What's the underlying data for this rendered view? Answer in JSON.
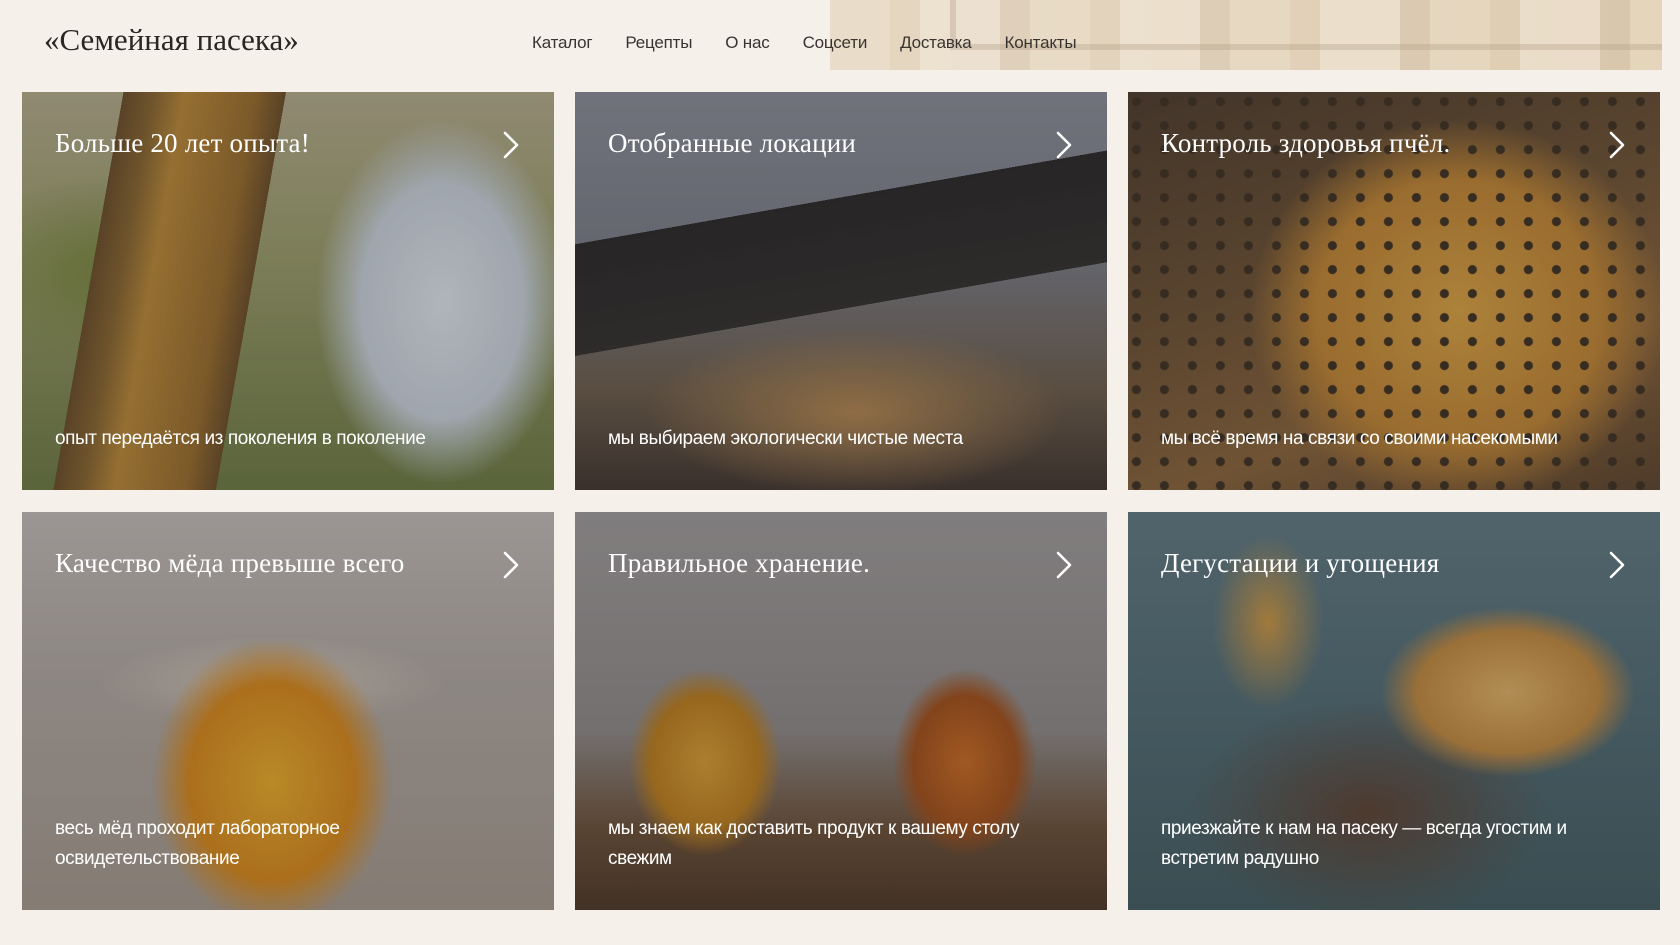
{
  "brand": {
    "logo": "«Семейная пасека»"
  },
  "nav": {
    "items": [
      {
        "label": "Каталог"
      },
      {
        "label": "Рецепты"
      },
      {
        "label": "О нас"
      },
      {
        "label": "Соцсети"
      },
      {
        "label": "Доставка"
      },
      {
        "label": "Контакты"
      }
    ]
  },
  "cards": [
    {
      "title": "Больше 20 лет опыта!",
      "caption": "опыт передаётся из поколения в поколение",
      "icon": "chevron-right-icon"
    },
    {
      "title": "Отобранные локации",
      "caption": "мы выбираем экологически чистые места",
      "icon": "chevron-right-icon"
    },
    {
      "title": "Контроль здоровья пчёл.",
      "caption": "мы всё время на связи со своими насекомыми",
      "icon": "chevron-right-icon"
    },
    {
      "title": "Качество мёда превыше всего",
      "caption": "весь мёд проходит лабораторное освидетельствование",
      "icon": "chevron-right-icon"
    },
    {
      "title": "Правильное хранение.",
      "caption": "мы знаем как доставить продукт к вашему столу свежим",
      "icon": "chevron-right-icon"
    },
    {
      "title": "Дегустации и угощения",
      "caption": "приезжайте к нам на пасеку — всегда угостим и встретим радушно",
      "icon": "chevron-right-icon"
    }
  ],
  "colors": {
    "page_background": "#f5f0ea",
    "text_dark": "#2b2622",
    "card_text": "#ffffff"
  }
}
